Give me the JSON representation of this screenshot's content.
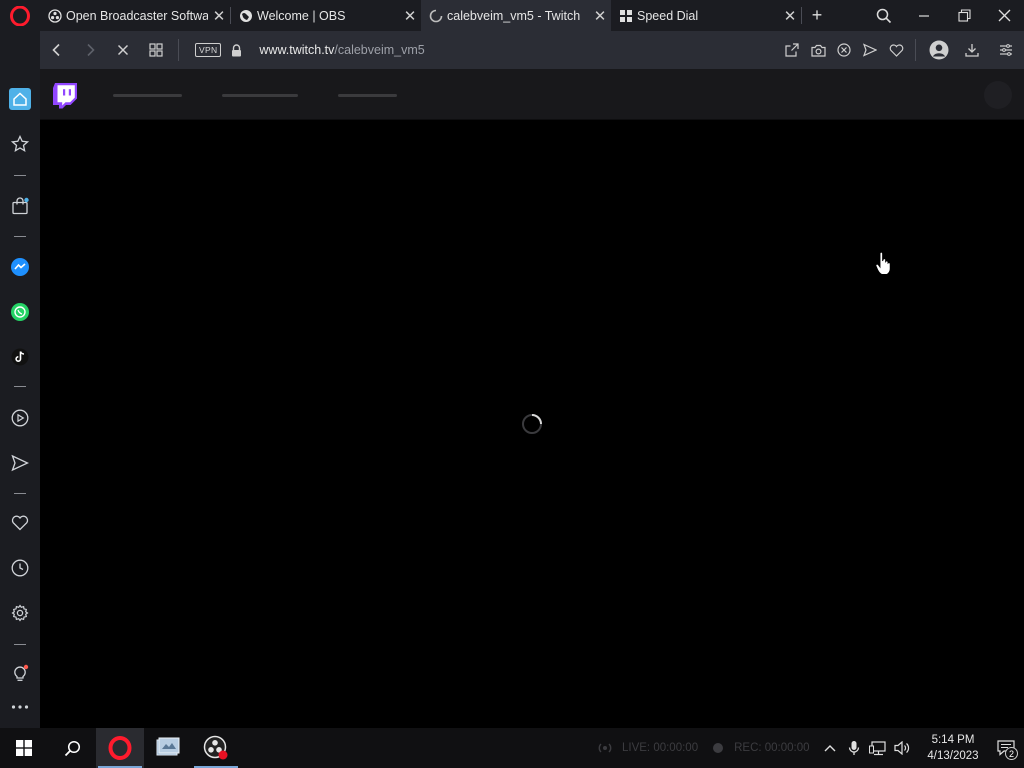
{
  "browser": {
    "tabs": [
      {
        "title": "Open Broadcaster Software",
        "icon": "obs-icon",
        "active": false
      },
      {
        "title": "Welcome | OBS",
        "icon": "globe-icon",
        "active": false
      },
      {
        "title": "calebveim_vm5 - Twitch",
        "icon": "loading-icon",
        "active": true
      },
      {
        "title": "Speed Dial",
        "icon": "speed-dial-icon",
        "active": false
      }
    ],
    "tab_close_glyph": "✕",
    "new_tab_glyph": "+",
    "vpn_label": "VPN",
    "url_host": "www.twitch.tv",
    "url_path": "/calebveim_vm5"
  },
  "colors": {
    "twitch_purple": "#9146ff",
    "opera_red": "#ff1b2d",
    "home_blue": "#4fb1e8",
    "messenger_blue": "#1e90ff",
    "whatsapp_green": "#25d366"
  },
  "taskbar": {
    "obs_live": "LIVE: 00:00:00",
    "obs_rec": "REC: 00:00:00",
    "time": "5:14 PM",
    "date": "4/13/2023",
    "notifications": "2"
  }
}
